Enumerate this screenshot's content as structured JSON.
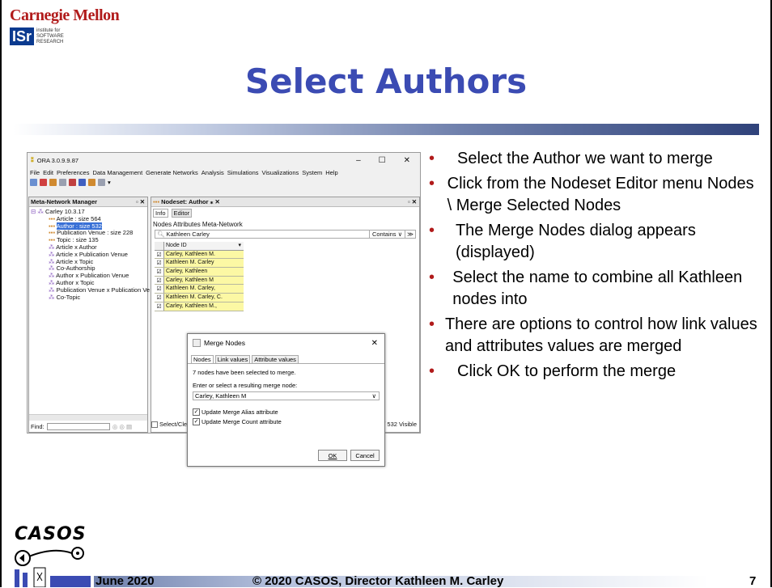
{
  "header": {
    "cmu": "Carnegie Mellon",
    "isr_logo": "ISr",
    "isr_text": "institute for SOFTWARE RESEARCH"
  },
  "title": "Select Authors",
  "app": {
    "window_title": "ORA 3.0.9.9.87",
    "menu": [
      "File",
      "Edit",
      "Preferences",
      "Data Management",
      "Generate Networks",
      "Analysis",
      "Simulations",
      "Visualizations",
      "System",
      "Help"
    ],
    "mm_title": "Meta-Network Manager",
    "tree": [
      "Carley 10.3.17",
      "Article : size 564",
      "Author : size 532",
      "Publication Venue : size 228",
      "Topic : size 135",
      "Article x Author",
      "Article x Publication Venue",
      "Article x Topic",
      "Co-Authorship",
      "Author x Publication Venue",
      "Author x Topic",
      "Publication Venue x Publication Ve",
      "Co-Topic"
    ],
    "find_label": "Find:",
    "ns_title": "Nodeset: Author",
    "tabs": [
      "Info",
      "Editor"
    ],
    "submenu": "Nodes  Attributes  Meta-Network",
    "search_value": "Kathleen Carley",
    "contains": "Contains",
    "col_header": "Node ID",
    "nodes": [
      "Carley, Kathleen M.",
      "Kathleen M. Carley",
      "Carley, Kathleen",
      "Carley, Kathleen M",
      "Kathleen M. Carley,",
      "Kathleen M. Carley, C.",
      "Carley, Kathleen M.,"
    ],
    "select_label": "Select/Cle",
    "visible": "/ 532 Visible"
  },
  "dialog": {
    "title": "Merge Nodes",
    "tabs": [
      "Nodes",
      "Link values",
      "Attribute values"
    ],
    "info": "7 nodes have been selected to merge.",
    "prompt": "Enter or select a resulting merge node:",
    "selected": "Carley, Kathleen M",
    "check1": "Update Merge Alias attribute",
    "check2": "Update Merge Count attribute",
    "ok": "OK",
    "cancel": "Cancel"
  },
  "bullets": [
    "Select the Author we want to merge",
    "Click from the Nodeset Editor menu Nodes \\ Merge Selected Nodes",
    "The Merge Nodes dialog appears (displayed)",
    "Select the name to combine all Kathleen nodes into",
    "There are options to control how link values and attributes values are merged",
    "Click OK to perform the merge"
  ],
  "footer": {
    "date": "June 2020",
    "copyright": "© 2020 CASOS, Director Kathleen M. Carley",
    "page": "7",
    "casos": "CASOS"
  },
  "colors": {
    "title": "#3b4bb3",
    "cmu": "#b11b1b",
    "bullet": "#b11b1b",
    "node_cell": "#fcf8a4",
    "selection": "#3870d6"
  }
}
